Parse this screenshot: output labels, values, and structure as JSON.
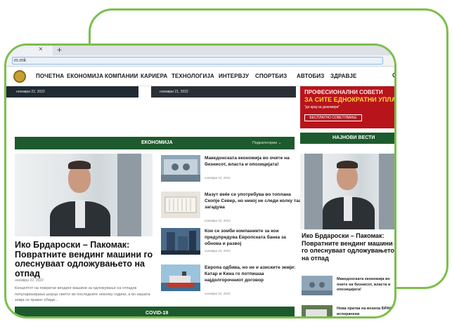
{
  "browser": {
    "tab_close": "×",
    "tab_new": "+",
    "url": "m.mk"
  },
  "nav": {
    "items": [
      "ПОЧЕТНА",
      "ЕКОНОМИЈА",
      "КОМПАНИИ",
      "КАРИЕРА",
      "ТЕХНОЛОГИЈА",
      "ИНТЕРВЈУ",
      "СПОРТБИЗ",
      "АВТОБИЗ",
      "ЗДРАВЈЕ"
    ]
  },
  "top_strip": {
    "date_left": "ноември 22, 2022",
    "date_middle": "ноември 21, 2022"
  },
  "ad": {
    "line1": "ПРОФЕСИОНАЛНИ СОВЕТИ",
    "line2": "ЗА СИТЕ ЕДНОКРАТНИ УПЛАТИ",
    "line3": "\"до крај на декември\"",
    "button": "БЕСПЛАТНО СОВЕТУВАЊЕ"
  },
  "section_economy": {
    "title": "ЕКОНОМИЈА",
    "subcategories": "Подкатегории ⌄"
  },
  "latest": {
    "title": "НАЈНОВИ ВЕСТИ"
  },
  "main_article": {
    "title": "Ико Брдароски – Пакомак: Повратните вендинг машини го олеснуваат одложувањето на отпад",
    "date": "ноември 22, 2022",
    "excerpt": "Концептот на повратни вендинг машини за одложување на отпадок популаризирање шорцо светот во последните неколку години, а во нашата земја се прават обиди..."
  },
  "news_list": [
    {
      "title": "Македонската економија во очите на бизнисот, власта и опозицијата!",
      "date": "ноември 22, 2022"
    },
    {
      "title": "Мазут веќе се употребува во топлана Скопје Север, но никој не следи колку таа загадува",
      "date": "ноември 22, 2022"
    },
    {
      "title": "Кои се зомби компаниите за кои предупредува Европската банка за обнова и развој",
      "date": "ноември 22, 2022"
    },
    {
      "title": "Европа одбива, но не и азиските земји: Катар и Кина го потпишаа најдолгорочниот договор",
      "date": "ноември 22, 2022"
    }
  ],
  "side_article": {
    "title": "Ико Брдароски – Пакомак: Повратните вендинг машини го олеснуваат одложувањето на отпад"
  },
  "side_list": [
    {
      "title": "Македонската економија во очите на бизнисот, власта и опозицијата!"
    },
    {
      "title": "Нова пратка на возила БРАКО испорачени"
    }
  ],
  "section_covid": {
    "title": "COVID-19"
  },
  "colors": {
    "frame_green": "#7cbf4a",
    "section_green": "#1d5a2d",
    "ad_red": "#b8141b"
  },
  "icons": {
    "search": "search-icon",
    "logo": "site-logo"
  }
}
